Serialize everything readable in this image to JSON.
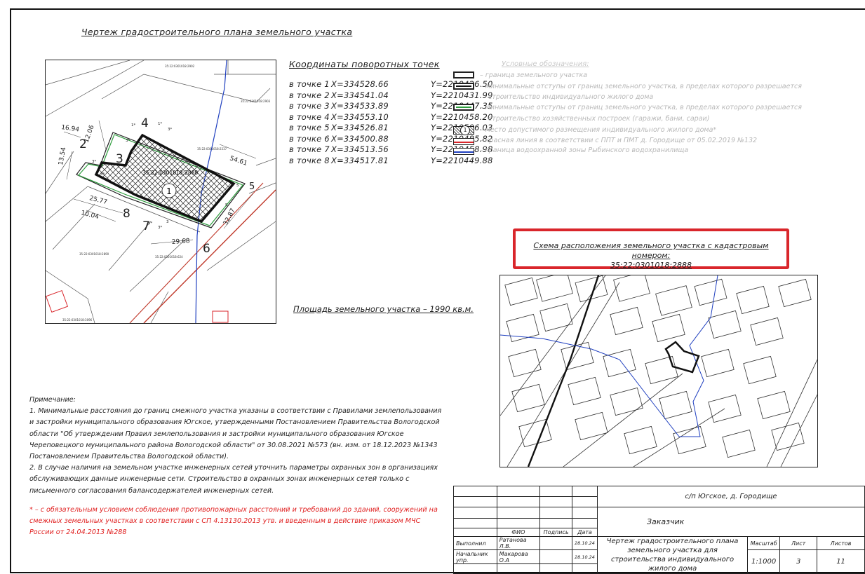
{
  "title": "Чертеж градостроительного плана земельного участка",
  "plan": {
    "cadastral_number": "35:22:0301018:2888",
    "parcel_marker": "1",
    "neighbor_labels": [
      "35:22:0301018:2902",
      "35:22:0301018:2903",
      "35:22:0301018:2237",
      "35:22:0301018:2890",
      "35:22:0301018:624",
      "35:22:0301018:3096"
    ],
    "point_numbers": [
      "2",
      "3",
      "4",
      "5",
      "6",
      "7",
      "8"
    ],
    "dimensions": [
      "16.94",
      "12.06",
      "13.54",
      "54.61",
      "25.77",
      "10.04",
      "29.68",
      "32.87"
    ],
    "setback_marks": [
      "3*",
      "1*",
      "3*",
      "1*",
      "3*",
      "1*",
      "3*",
      "3*",
      "5",
      "5",
      "3"
    ]
  },
  "coordinates": {
    "title": "Координаты поворотных точек",
    "rows": [
      {
        "label": "в точке 1",
        "x": "X=334528.66",
        "y": "Y=2210426.50"
      },
      {
        "label": "в точке 2",
        "x": "X=334541.04",
        "y": "Y=2210431.99"
      },
      {
        "label": "в точке 3",
        "x": "X=334533.89",
        "y": "Y=2210447.35"
      },
      {
        "label": "в точке 4",
        "x": "X=334553.10",
        "y": "Y=2210458.20"
      },
      {
        "label": "в точке 5",
        "x": "X=334526.81",
        "y": "Y=2210506.03"
      },
      {
        "label": "в точке 6",
        "x": "X=334500.88",
        "y": "Y=2210485.82"
      },
      {
        "label": "в точке 7",
        "x": "X=334513.56",
        "y": "Y=2210458.98"
      },
      {
        "label": "в точке 8",
        "x": "X=334517.81",
        "y": "Y=2210449.88"
      }
    ]
  },
  "area_text": "Площадь земельного участка – 1990 кв.м.",
  "legend": {
    "title": "Условные обозначения:",
    "items": [
      {
        "text": "– граница земельного участка"
      },
      {
        "text": "– минимальные отступы от границ земельного участка, в пределах которого разрешается"
      },
      {
        "text": "строительство индивидуального жилого дома"
      },
      {
        "text": "– минимальные отступы от границ земельного участка, в пределах которого разрешается"
      },
      {
        "text": "строительство хозяйственных построек (гаражи, бани, сараи)"
      },
      {
        "text": "– место допустимого размещения индивидуального жилого дома*"
      },
      {
        "text": "– красная линия в соответствии с ППТ и ПМТ д. Городище от 05.02.2019 №132"
      },
      {
        "text": "– граница водоохранной зоны Рыбинского водохранилища"
      }
    ],
    "symbol_marker": "1"
  },
  "scheme": {
    "title_line1": "Схема расположения земельного участка с кадастровым номером:",
    "title_line2": "35:22:0301018:2888"
  },
  "notes": {
    "heading": "Примечание:",
    "p1": "1. Минимальные расстояния до границ смежного участка указаны в соответствии с Правилами землепользования и застройки муниципального образования Югское, утвержденными Постановлением Правительства Вологодской области \"Об утверждении Правил землепользования и застройки муниципального образования Югское Череповецкого муниципального района Вологодской области\" от 30.08.2021 №573 (вн. изм. от 18.12.2023 №1343 Постановлением Правительства Вологодской области).",
    "p2": "2. В случае наличия на земельном участке инженерных сетей уточнить параметры охранных зон в организациях обслуживающих данные инженерные сети. Строительство в охранных зонах инженерных сетей только с письменного согласования балансодержателей инженерных сетей.",
    "red": "* – с обязательным условием соблюдения противопожарных расстояний и требований до зданий, сооружений на смежных земельных участках в соответствии с СП 4.13130.2013 утв. и введенным в действие приказом МЧС России от 24.04.2013 №288"
  },
  "stamp": {
    "location": "с/п Югское, д. Городище",
    "customer": "Заказчик",
    "col_fio": "ФИО",
    "col_sign": "Подпись",
    "col_date": "Дата",
    "role1": "Выполнил",
    "name1": "Ратанова Л.В.",
    "date1": "28.10.24",
    "role2": "Начальник упр.",
    "name2": "Макарова О.А",
    "date2": "28.10.24",
    "doc_title": "Чертеж градостроительного плана земельного участка для строительства индивидуального жилого дома",
    "scale_label": "Масштаб",
    "sheet_label": "Лист",
    "sheets_label": "Листов",
    "scale": "1:1000",
    "sheet": "3",
    "sheets": "11"
  }
}
